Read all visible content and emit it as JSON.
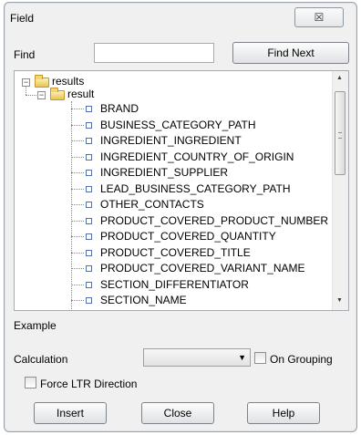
{
  "window": {
    "title": "Field",
    "close_glyph": "☒"
  },
  "find": {
    "label": "Find",
    "value": "",
    "button_label": "Find Next"
  },
  "tree": {
    "root": {
      "label": "results",
      "expander": "−"
    },
    "child": {
      "label": "result",
      "expander": "−"
    },
    "fields": [
      "BRAND",
      "BUSINESS_CATEGORY_PATH",
      "INGREDIENT_INGREDIENT",
      "INGREDIENT_COUNTRY_OF_ORIGIN",
      "INGREDIENT_SUPPLIER",
      "LEAD_BUSINESS_CATEGORY_PATH",
      "OTHER_CONTACTS",
      "PRODUCT_COVERED_PRODUCT_NUMBER",
      "PRODUCT_COVERED_QUANTITY",
      "PRODUCT_COVERED_TITLE",
      "PRODUCT_COVERED_VARIANT_NAME",
      "SECTION_DIFFERENTIATOR",
      "SECTION_NAME"
    ],
    "scroll_up_glyph": "▲",
    "scroll_down_glyph": "▼"
  },
  "example": {
    "label": "Example"
  },
  "calculation": {
    "label": "Calculation",
    "value": "",
    "arrow_glyph": "▼",
    "on_grouping_label": "On Grouping"
  },
  "force_ltr": {
    "label": "Force LTR Direction"
  },
  "buttons": {
    "insert": "Insert",
    "close": "Close",
    "help": "Help"
  }
}
